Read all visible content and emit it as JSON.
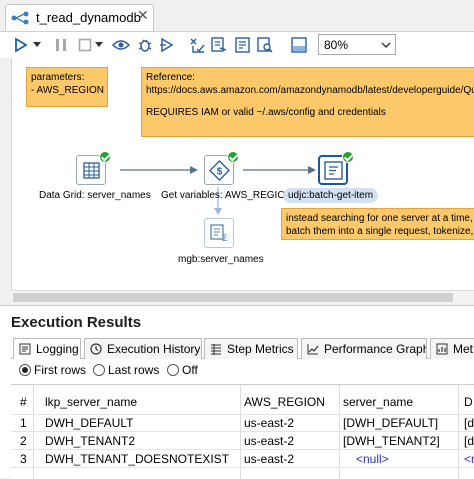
{
  "editor_tab": {
    "title": "t_read_dynamodb",
    "close": "✕"
  },
  "toolbar": {
    "zoom_value": "80%"
  },
  "canvas": {
    "notes": {
      "parameters": [
        "parameters:",
        "- AWS_REGION"
      ],
      "reference": [
        "Reference:",
        "https://docs.aws.amazon.com/amazondynamodb/latest/developerguide/Que",
        "",
        "REQUIRES IAM or valid ~/.aws/config and credentials"
      ],
      "batch": [
        "instead searching for one server at a time,",
        "batch them into a single request, tokenize, pu"
      ]
    },
    "steps": {
      "data_grid": "Data Grid: server_names",
      "get_variables": "Get variables: AWS_REGION",
      "udjc": "udjc:batch-get-item",
      "mgb": "mgb:server_names"
    }
  },
  "results": {
    "title": "Execution Results",
    "tabs": [
      "Logging",
      "Execution History",
      "Step Metrics",
      "Performance Graph",
      "Met"
    ],
    "radios": [
      "First rows",
      "Last rows",
      "Off"
    ],
    "columns": [
      "#",
      "lkp_server_name",
      "AWS_REGION",
      "server_name",
      "D"
    ],
    "rows": [
      [
        "1",
        "DWH_DEFAULT",
        "us-east-2",
        "[DWH_DEFAULT]",
        "[d"
      ],
      [
        "2",
        "DWH_TENANT2",
        "us-east-2",
        "[DWH_TENANT2]",
        "[d"
      ],
      [
        "3",
        "DWH_TENANT_DOESNOTEXIST",
        "us-east-2",
        "<null>",
        "<n"
      ]
    ]
  },
  "colors": {
    "note_bg": "#fcc96a",
    "badge": "#21a12f",
    "null_text": "#2b33c9",
    "selected_step": "#d3e1f2"
  }
}
